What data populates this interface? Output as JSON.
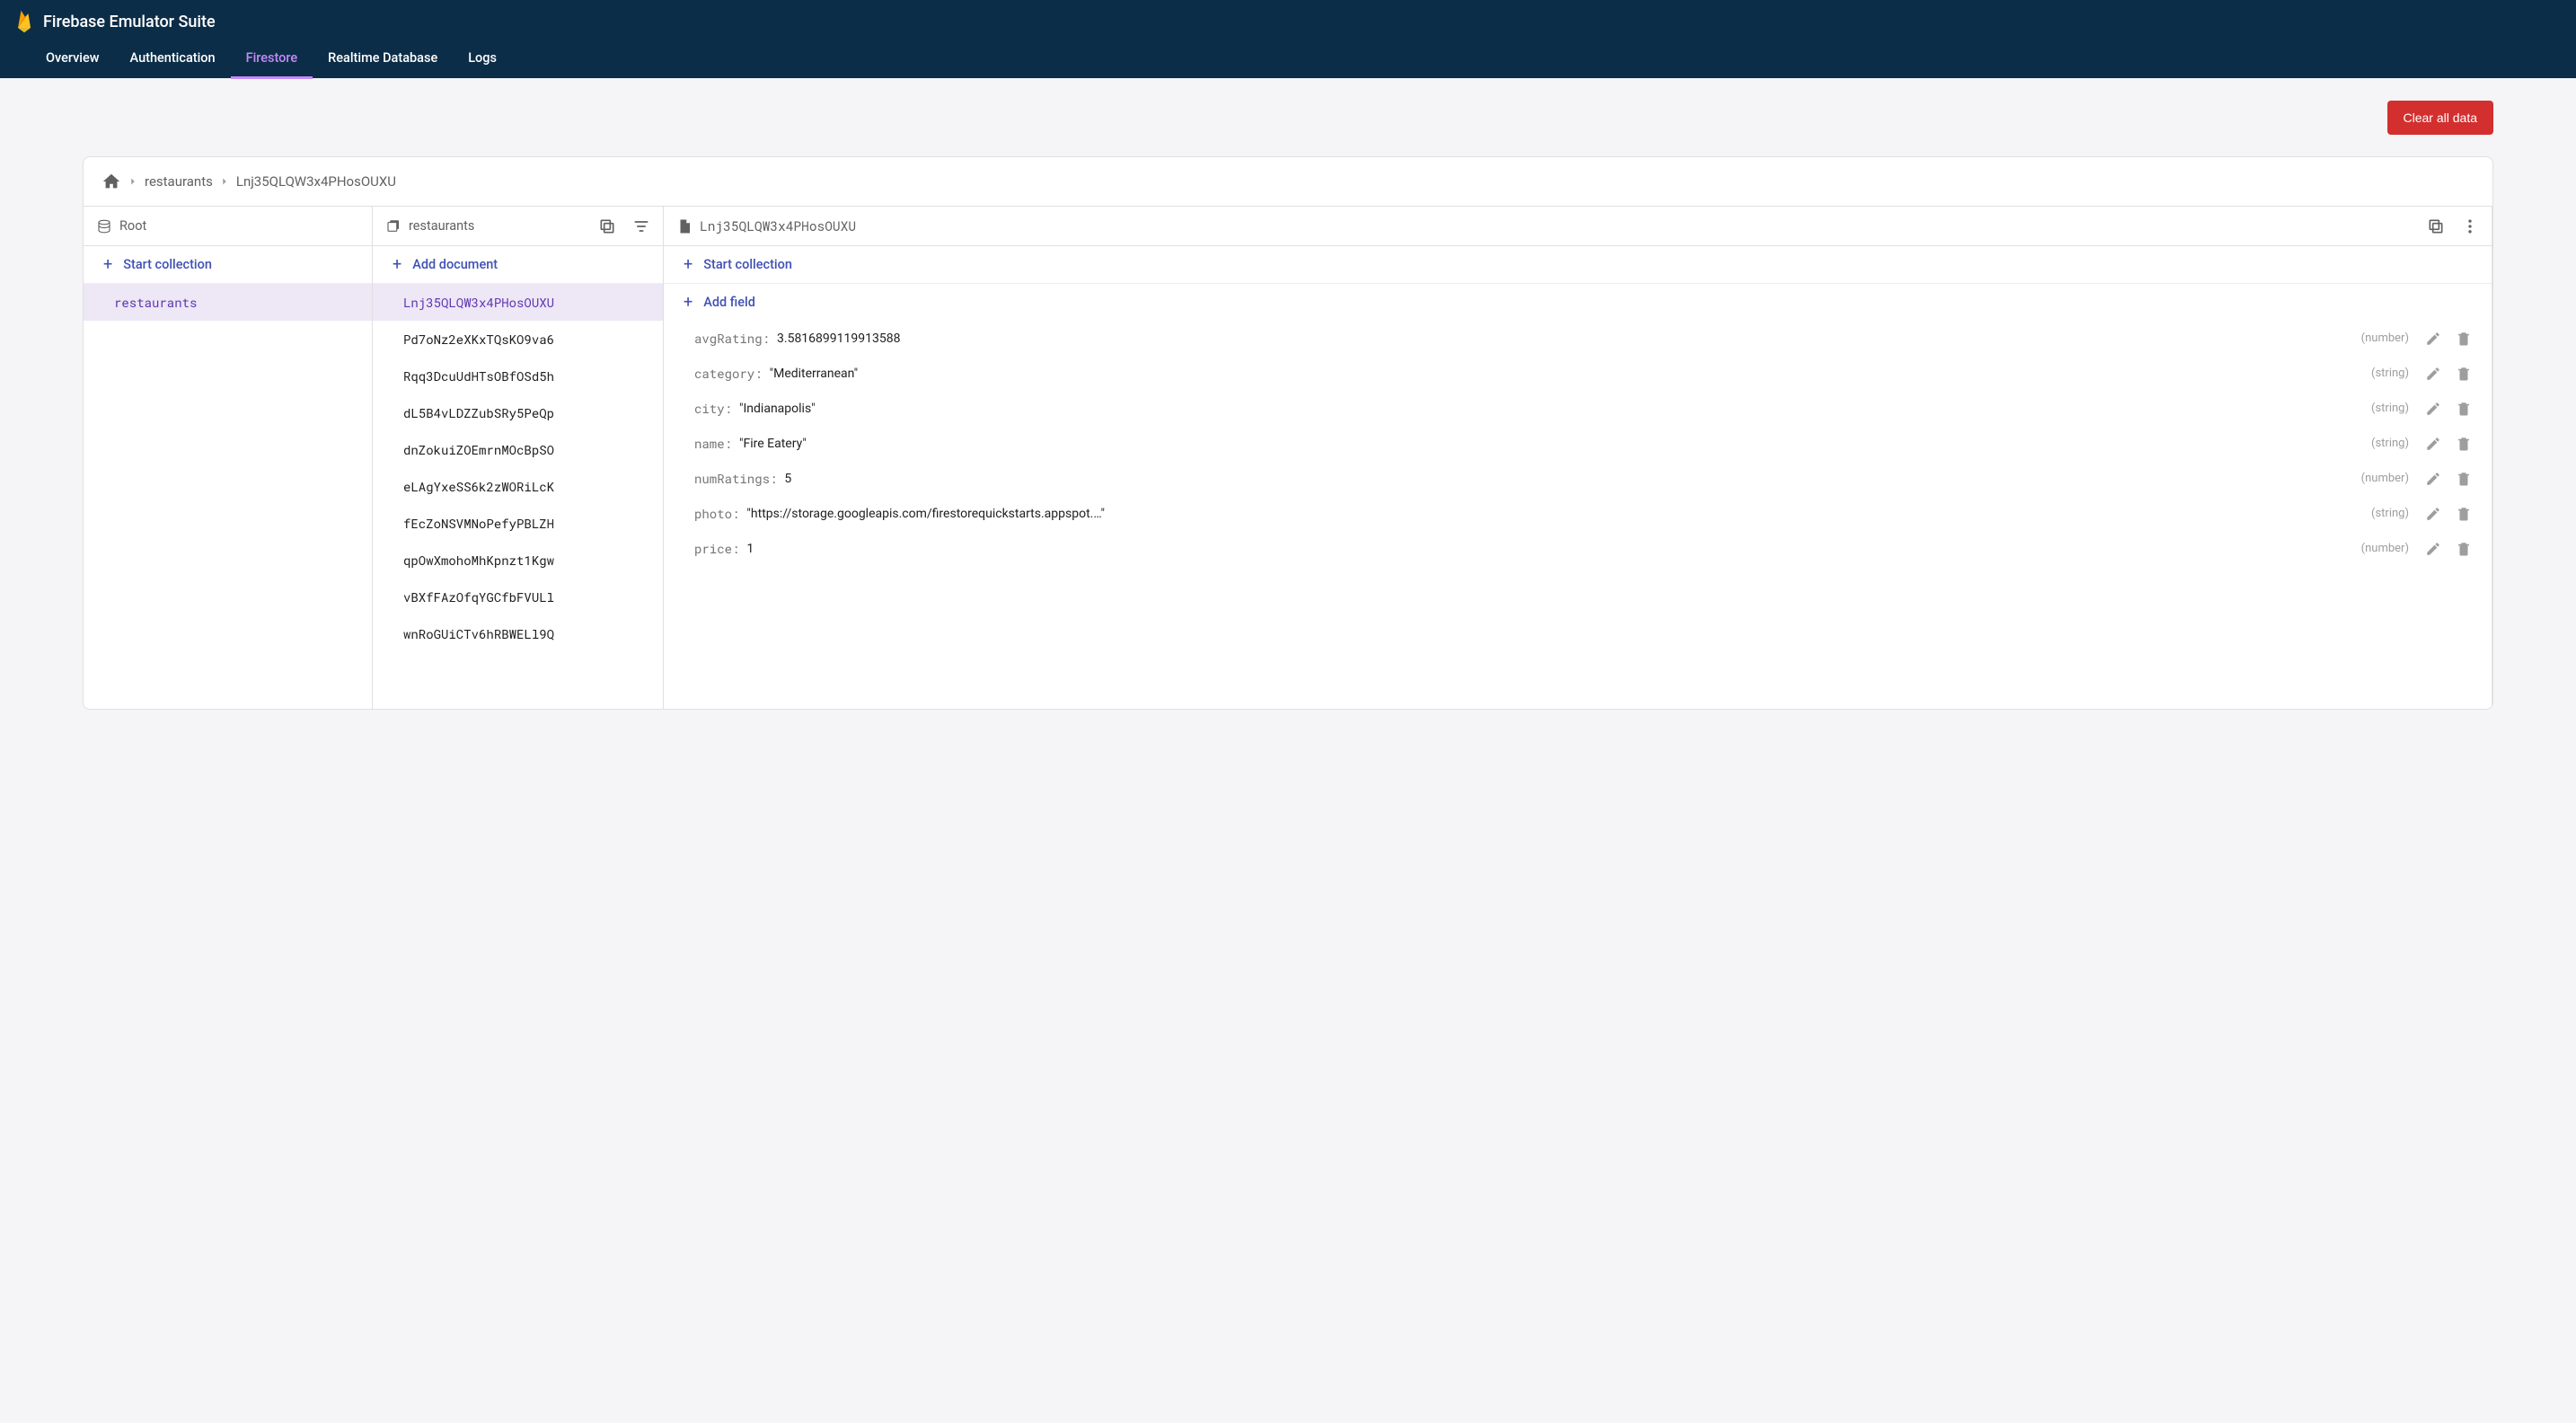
{
  "brand": {
    "title": "Firebase Emulator Suite"
  },
  "tabs": [
    {
      "label": "Overview",
      "active": false
    },
    {
      "label": "Authentication",
      "active": false
    },
    {
      "label": "Firestore",
      "active": true
    },
    {
      "label": "Realtime Database",
      "active": false
    },
    {
      "label": "Logs",
      "active": false
    }
  ],
  "toolbar": {
    "clear_label": "Clear all data"
  },
  "breadcrumbs": [
    {
      "label": "restaurants"
    },
    {
      "label": "Lnj35QLQW3x4PHosOUXU"
    }
  ],
  "columns": {
    "root": {
      "header": "Root",
      "add_label": "Start collection",
      "items": [
        {
          "label": "restaurants",
          "selected": true
        }
      ]
    },
    "documents": {
      "header": "restaurants",
      "add_label": "Add document",
      "items": [
        {
          "label": "Lnj35QLQW3x4PHosOUXU",
          "selected": true
        },
        {
          "label": "Pd7oNz2eXKxTQsKO9va6",
          "selected": false
        },
        {
          "label": "Rqq3DcuUdHTsOBfOSd5h",
          "selected": false
        },
        {
          "label": "dL5B4vLDZZubSRy5PeQp",
          "selected": false
        },
        {
          "label": "dnZokuiZOEmrnMOcBpSO",
          "selected": false
        },
        {
          "label": "eLAgYxeSS6k2zWORiLcK",
          "selected": false
        },
        {
          "label": "fEcZoNSVMNoPefyPBLZH",
          "selected": false
        },
        {
          "label": "qpOwXmohoMhKpnzt1Kgw",
          "selected": false
        },
        {
          "label": "vBXfFAzOfqYGCfbFVULl",
          "selected": false
        },
        {
          "label": "wnRoGUiCTv6hRBWELl9Q",
          "selected": false
        }
      ]
    },
    "fields": {
      "header": "Lnj35QLQW3x4PHosOUXU",
      "start_collection_label": "Start collection",
      "add_field_label": "Add field",
      "items": [
        {
          "key": "avgRating",
          "value": "3.5816899119913588",
          "type": "number",
          "quoted": false
        },
        {
          "key": "category",
          "value": "Mediterranean",
          "type": "string",
          "quoted": true
        },
        {
          "key": "city",
          "value": "Indianapolis",
          "type": "string",
          "quoted": true
        },
        {
          "key": "name",
          "value": "Fire Eatery",
          "type": "string",
          "quoted": true
        },
        {
          "key": "numRatings",
          "value": "5",
          "type": "number",
          "quoted": false
        },
        {
          "key": "photo",
          "value": "https://storage.googleapis.com/firestorequickstarts.appspot.…",
          "type": "string",
          "quoted": true
        },
        {
          "key": "price",
          "value": "1",
          "type": "number",
          "quoted": false
        }
      ]
    }
  }
}
